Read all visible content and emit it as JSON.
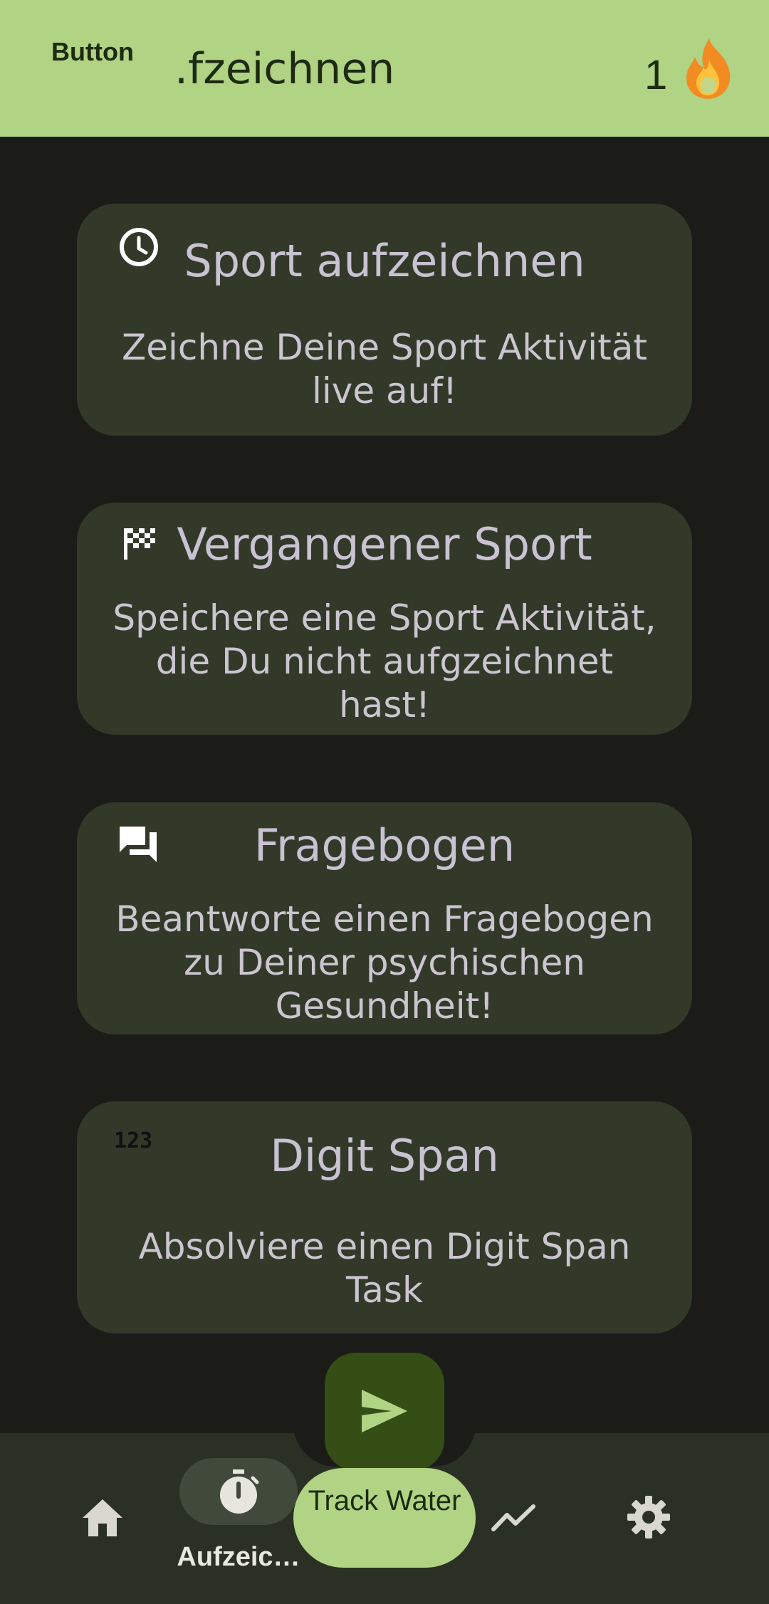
{
  "topbar": {
    "button_label": "Button",
    "title": ".fzeichnen",
    "streak_count": "1",
    "streak_icon": "flame-icon"
  },
  "cards": [
    {
      "icon": "clock-icon",
      "title": "Sport aufzeichnen",
      "description": "Zeichne Deine Sport Aktivität live auf!"
    },
    {
      "icon": "checkered-flag-icon",
      "title": "Vergangener Sport",
      "description": "Speichere eine Sport Aktivität, die Du nicht aufgzeichnet hast!"
    },
    {
      "icon": "chat-bubbles-icon",
      "title": "Fragebogen",
      "description": "Beantworte einen Fragebogen zu Deiner psychischen Gesundheit!"
    },
    {
      "icon": "numbers-123-icon",
      "title": "Digit Span",
      "description": "Absolviere einen Digit Span Task"
    }
  ],
  "bottom_nav": {
    "items": [
      {
        "icon": "home-icon",
        "label": ""
      },
      {
        "icon": "stopwatch-icon",
        "label": "Aufzeic…",
        "selected": true
      },
      {
        "icon": "trending-up-icon",
        "label": ""
      },
      {
        "icon": "settings-gear-icon",
        "label": ""
      }
    ],
    "fab_icon": "send-icon",
    "track_water_label": "Track Water"
  },
  "colors": {
    "background": "#1b1c18",
    "topbar": "#b1d384",
    "card": "#323929",
    "fab": "#344e16",
    "nav": "#2b3024"
  }
}
